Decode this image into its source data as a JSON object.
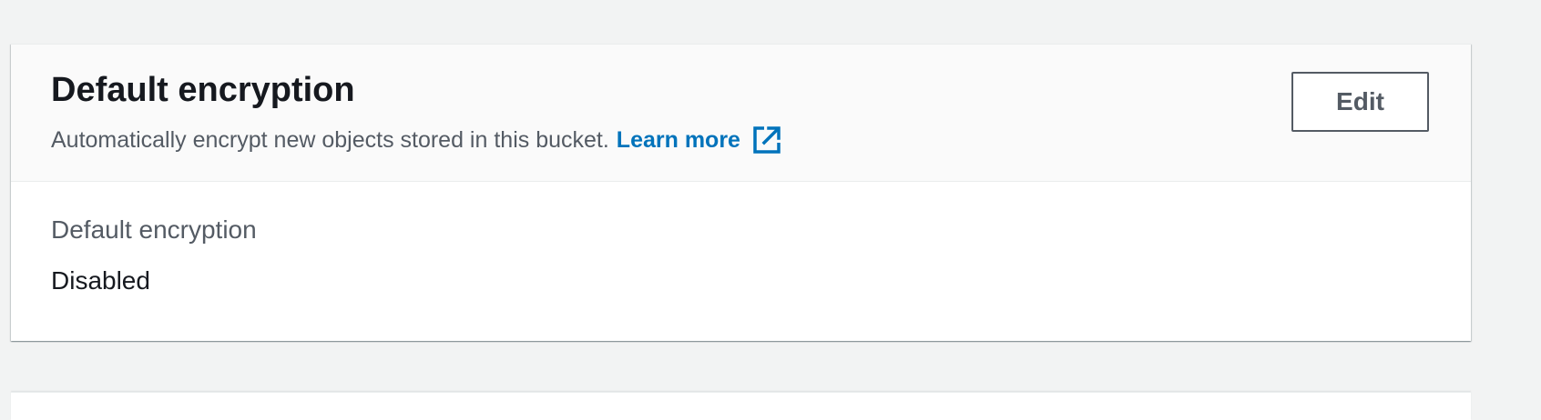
{
  "panel": {
    "title": "Default encryption",
    "description": "Automatically encrypt new objects stored in this bucket.",
    "learn_more_label": "Learn more",
    "learn_more_icon": "external-link-icon",
    "edit_label": "Edit",
    "field": {
      "label": "Default encryption",
      "value": "Disabled"
    }
  },
  "colors": {
    "page_background": "#f2f3f3",
    "header_background": "#fafafa",
    "link": "#0073bb",
    "title_text": "#16191f",
    "secondary_text": "#545b64"
  }
}
